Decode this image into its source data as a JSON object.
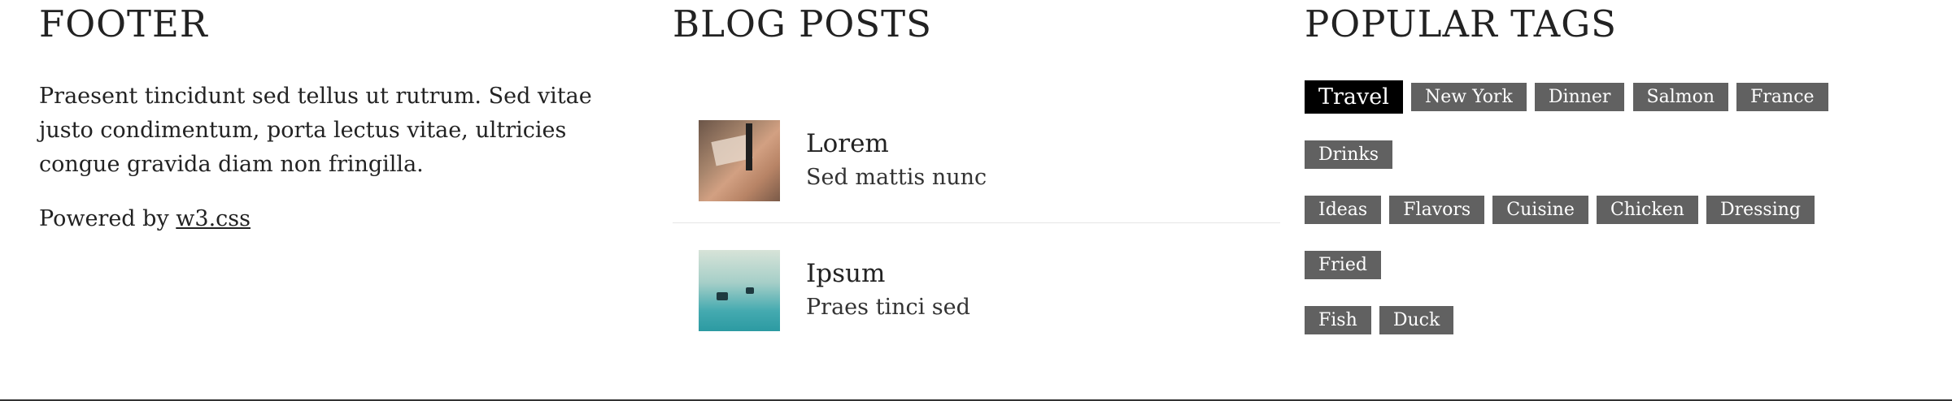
{
  "footer": {
    "heading": "FOOTER",
    "text": "Praesent tincidunt sed tellus ut rutrum. Sed vitae justo condimentum, porta lectus vitae, ultricies congue gravida diam non fringilla.",
    "powered_prefix": "Powered by ",
    "powered_link": "w3.css"
  },
  "blog": {
    "heading": "BLOG POSTS",
    "posts": [
      {
        "title": "Lorem",
        "subtitle": "Sed mattis nunc",
        "image": "desk-photo"
      },
      {
        "title": "Ipsum",
        "subtitle": "Praes tinci sed",
        "image": "cable-car-photo"
      }
    ]
  },
  "tags": {
    "heading": "POPULAR TAGS",
    "items": [
      "Travel",
      "New York",
      "Dinner",
      "Salmon",
      "France",
      "Drinks",
      "Ideas",
      "Flavors",
      "Cuisine",
      "Chicken",
      "Dressing",
      "Fried",
      "Fish",
      "Duck"
    ],
    "active": "Travel"
  },
  "colors": {
    "tag_bg": "#616161",
    "tag_active_bg": "#000000",
    "text": "#222222"
  }
}
